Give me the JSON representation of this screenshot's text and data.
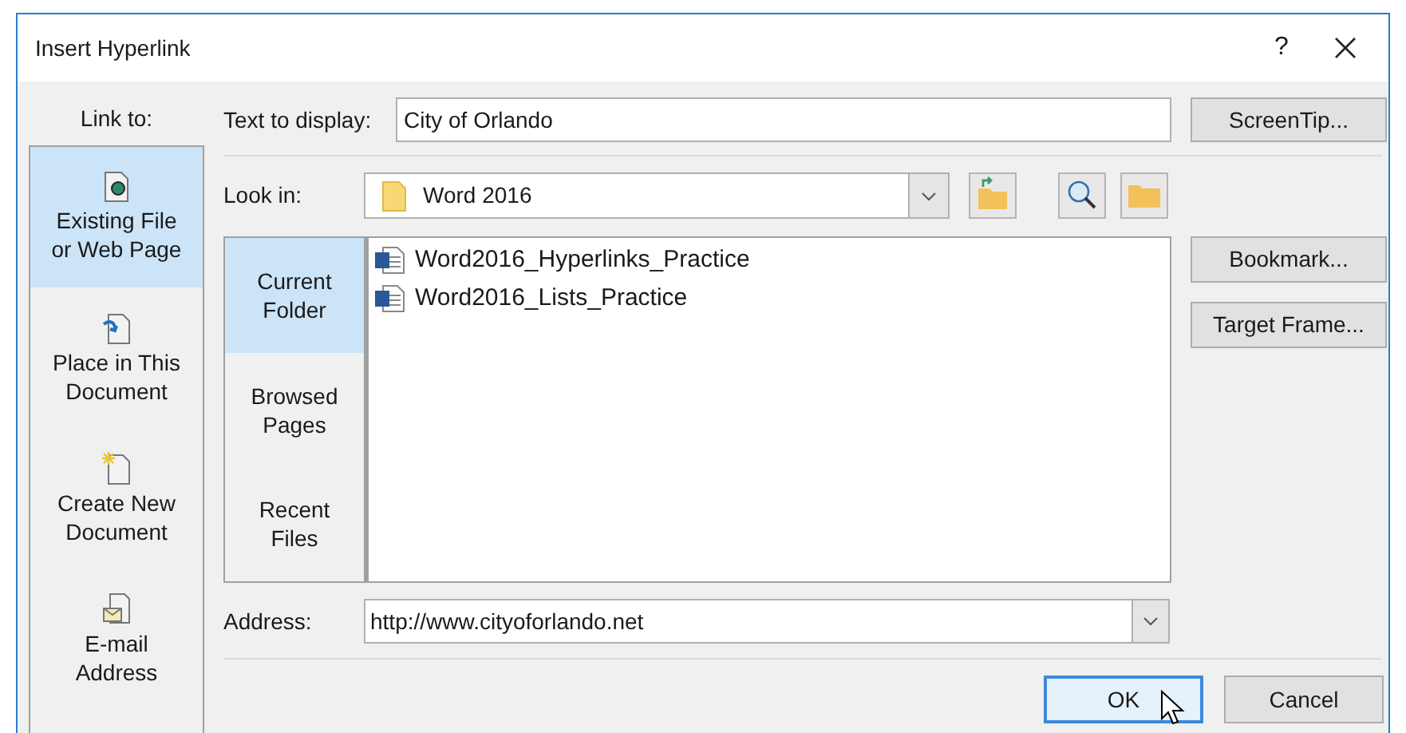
{
  "window": {
    "title": "Insert Hyperlink",
    "help": "?"
  },
  "link_to": {
    "label": "Link to:",
    "items": [
      {
        "label": "Existing File\nor Web Page",
        "kind": "file",
        "selected": true
      },
      {
        "label": "Place in This\nDocument",
        "kind": "place",
        "selected": false
      },
      {
        "label": "Create New\nDocument",
        "kind": "new",
        "selected": false
      },
      {
        "label": "E-mail\nAddress",
        "kind": "email",
        "selected": false
      }
    ]
  },
  "text_to_display": {
    "label": "Text to display:",
    "value": "City of Orlando"
  },
  "screentip_button": "ScreenTip...",
  "look_in": {
    "label": "Look in:",
    "value": "Word 2016"
  },
  "browse_tabs": [
    {
      "label": "Current\nFolder",
      "selected": true
    },
    {
      "label": "Browsed\nPages",
      "selected": false
    },
    {
      "label": "Recent\nFiles",
      "selected": false
    }
  ],
  "files": [
    {
      "name": "Word2016_Hyperlinks_Practice"
    },
    {
      "name": "Word2016_Lists_Practice"
    }
  ],
  "side_buttons": [
    "Bookmark...",
    "Target Frame..."
  ],
  "address": {
    "label": "Address:",
    "value": "http://www.cityoforlando.net"
  },
  "buttons": [
    {
      "label": "OK",
      "focused": true
    },
    {
      "label": "Cancel",
      "focused": false
    }
  ]
}
